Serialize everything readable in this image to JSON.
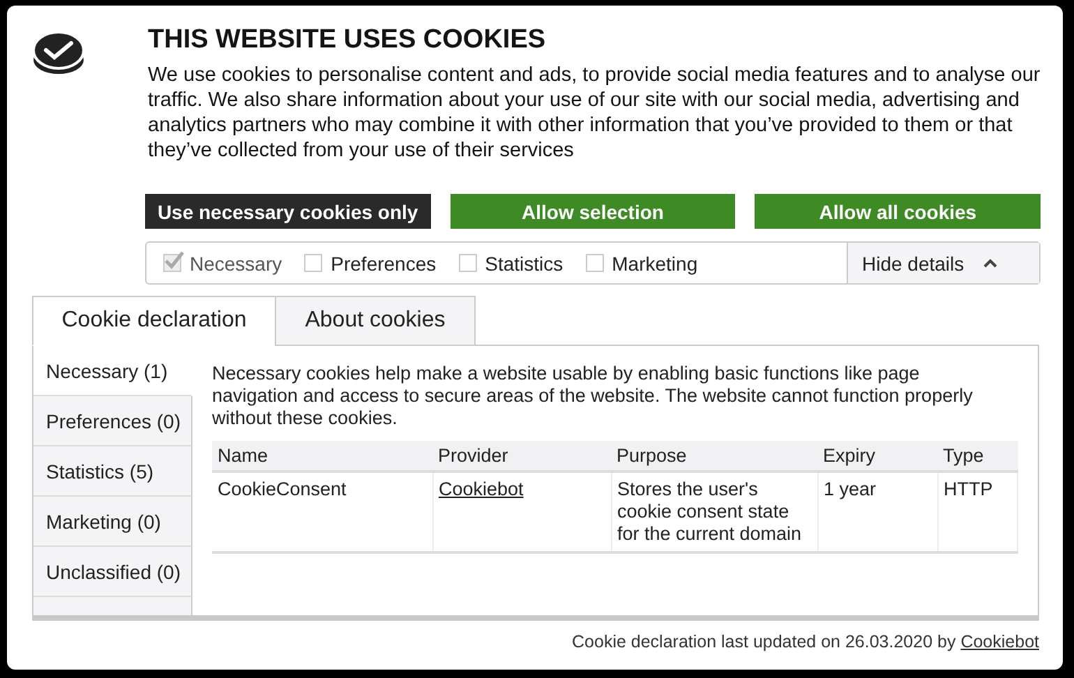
{
  "title": "THIS WEBSITE USES COOKIES",
  "intro": "We use cookies to personalise content and ads, to provide social media features and to analyse our traffic. We also share information about your use of our site with our social media, advertising and analytics partners who may combine it with other information that you’ve provided to them or that they’ve collected from your use of their services",
  "buttons": [
    {
      "label": "Use necessary cookies only",
      "kind": "dark"
    },
    {
      "label": "Allow selection",
      "kind": "green"
    },
    {
      "label": "Allow all cookies",
      "kind": "green"
    }
  ],
  "checkboxes": [
    {
      "label": "Necessary",
      "checked": true,
      "disabled": true
    },
    {
      "label": "Preferences",
      "checked": false,
      "disabled": false
    },
    {
      "label": "Statistics",
      "checked": false,
      "disabled": false
    },
    {
      "label": "Marketing",
      "checked": false,
      "disabled": false
    }
  ],
  "details_toggle": {
    "label": "Hide details",
    "expanded": true
  },
  "tabs": [
    {
      "label": "Cookie declaration",
      "selected": true
    },
    {
      "label": "About cookies",
      "selected": false
    }
  ],
  "categories": [
    {
      "label": "Necessary (1)",
      "selected": true
    },
    {
      "label": "Preferences (0)",
      "selected": false
    },
    {
      "label": "Statistics (5)",
      "selected": false
    },
    {
      "label": "Marketing (0)",
      "selected": false
    },
    {
      "label": "Unclassified (0)",
      "selected": false
    }
  ],
  "description": "Necessary cookies help make a website usable by enabling basic functions like page navigation and access to secure areas of the website. The website cannot function properly without these cookies.",
  "table": {
    "columns": [
      "Name",
      "Provider",
      "Purpose",
      "Expiry",
      "Type"
    ],
    "rows": [
      {
        "name": "CookieConsent",
        "provider": "Cookiebot",
        "purpose": "Stores the user's cookie consent state for the current domain",
        "expiry": "1 year",
        "type": "HTTP"
      }
    ]
  },
  "footer": {
    "text": "Cookie declaration last updated on 26.03.2020 by",
    "link": "Cookiebot"
  }
}
